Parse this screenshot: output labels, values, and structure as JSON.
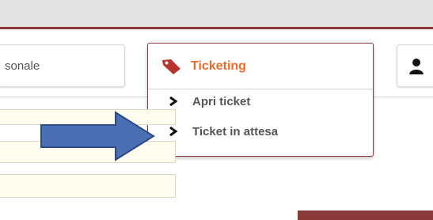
{
  "nav": {
    "personale_tab_label": "sonale",
    "ticketing_menu": {
      "title": "Ticketing",
      "icon": "tag-icon",
      "items": [
        {
          "label": "Apri ticket",
          "icon": "chevron-right-icon"
        },
        {
          "label": "Ticket in attesa",
          "icon": "chevron-right-icon"
        }
      ]
    },
    "user_icon": "user-icon"
  },
  "colors": {
    "accent": "#8b3a3a",
    "menu_title": "#ee6a2a",
    "tag_icon": "#b8322e",
    "arrow_fill": "#4a6fb3",
    "arrow_stroke": "#2b4a86"
  },
  "annotation": {
    "arrow_icon": "right-arrow-icon"
  }
}
